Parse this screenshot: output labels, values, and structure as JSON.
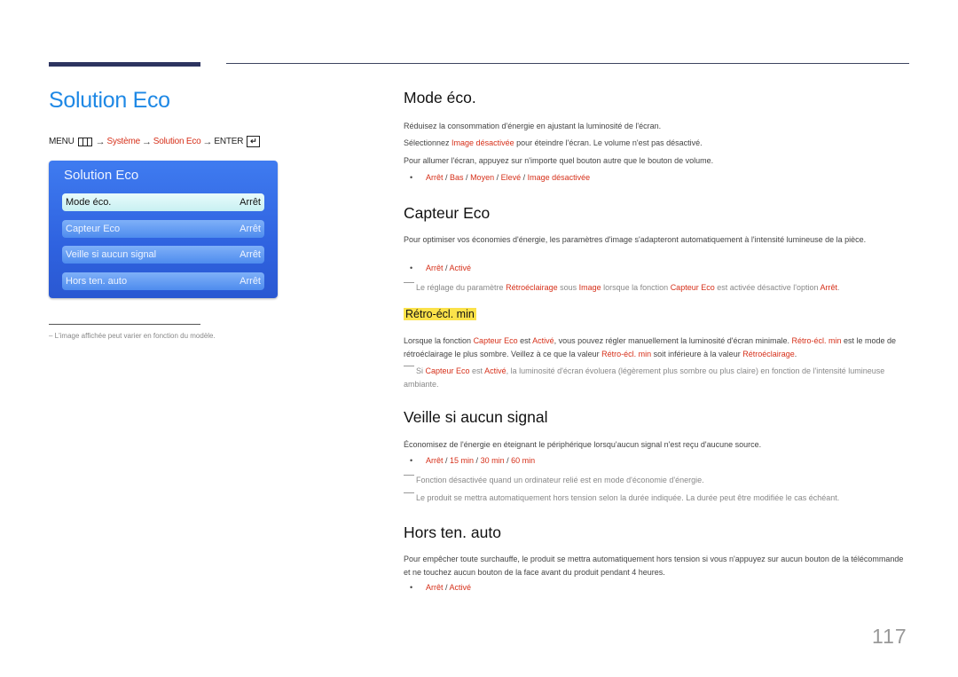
{
  "page_title": "Solution Eco",
  "menu_path": {
    "menu_label": "MENU",
    "systeme": "Système",
    "solution_eco": "Solution Eco",
    "enter_label": "ENTER",
    "arrow": "→",
    "enter_glyph": "↵"
  },
  "osd": {
    "title": "Solution Eco",
    "items": [
      {
        "label": "Mode éco.",
        "value": "Arrêt"
      },
      {
        "label": "Capteur Eco",
        "value": "Arrêt"
      },
      {
        "label": "Veille si aucun signal",
        "value": "Arrêt"
      },
      {
        "label": "Hors ten. auto",
        "value": "Arrêt"
      }
    ]
  },
  "footnote": "– L'image affichée peut varier en fonction du modèle.",
  "sections": {
    "mode_eco": {
      "title": "Mode éco.",
      "p1": "Réduisez la consommation d'énergie en ajustant la luminosité de l'écran.",
      "p2_a": "Sélectionnez ",
      "p2_red": "Image désactivée",
      "p2_b": " pour éteindre l'écran. Le volume n'est pas désactivé.",
      "p3": "Pour allumer l'écran, appuyez sur n'importe quel bouton autre que le bouton de volume.",
      "options": [
        "Arrêt",
        "Bas",
        "Moyen",
        "Elevé",
        "Image désactivée"
      ]
    },
    "capteur_eco": {
      "title": "Capteur Eco",
      "p1": "Pour optimiser vos économies d'énergie, les paramètres d'image s'adapteront automatiquement à l'intensité lumineuse de la pièce.",
      "options": [
        "Arrêt",
        "Activé"
      ],
      "note_a": "Le réglage du paramètre ",
      "note_r1": "Rétroéclairage",
      "note_b": " sous ",
      "note_r2": "Image",
      "note_c": " lorsque la fonction ",
      "note_r3": "Capteur Eco",
      "note_d": " est activée désactive l'option ",
      "note_r4": "Arrêt",
      "note_e": "."
    },
    "retro_min": {
      "title": "Rétro-écl. min",
      "p_a": "Lorsque la fonction ",
      "p_r1": "Capteur Eco",
      "p_b": " est ",
      "p_r2": "Activé",
      "p_c": ", vous pouvez régler manuellement la luminosité d'écran minimale. ",
      "p_r3": "Rétro-écl. min",
      "p_d": " est le mode de rétroéclairage le plus sombre. Veillez à ce que la valeur ",
      "p_r4": "Rétro-écl. min",
      "p_e": " soit inférieure à la valeur ",
      "p_r5": "Rétroéclairage",
      "p_f": ".",
      "note_a": "Si ",
      "note_r1": "Capteur Eco",
      "note_b": " est ",
      "note_r2": "Activé",
      "note_c": ", la luminosité d'écran évoluera (légèrement plus sombre ou plus claire) en fonction de l'intensité lumineuse ambiante."
    },
    "veille": {
      "title": "Veille si aucun signal",
      "p1": "Économisez de l'énergie en éteignant le périphérique lorsqu'aucun signal n'est reçu d'aucune source.",
      "options": [
        "Arrêt",
        "15 min",
        "30 min",
        "60 min"
      ],
      "note1": "Fonction désactivée quand un ordinateur relié est en mode d'économie d'énergie.",
      "note2": "Le produit se mettra automatiquement hors tension selon la durée indiquée. La durée peut être modifiée le cas échéant."
    },
    "hors_ten": {
      "title": "Hors ten. auto",
      "p1": "Pour empêcher toute surchauffe, le produit se mettra automatiquement hors tension si vous n'appuyez sur aucun bouton de la télécommande et ne touchez aucun bouton de la face avant du produit pendant 4 heures.",
      "options": [
        "Arrêt",
        "Activé"
      ]
    }
  },
  "separator": " / ",
  "bullet": "•",
  "page_number": "117"
}
